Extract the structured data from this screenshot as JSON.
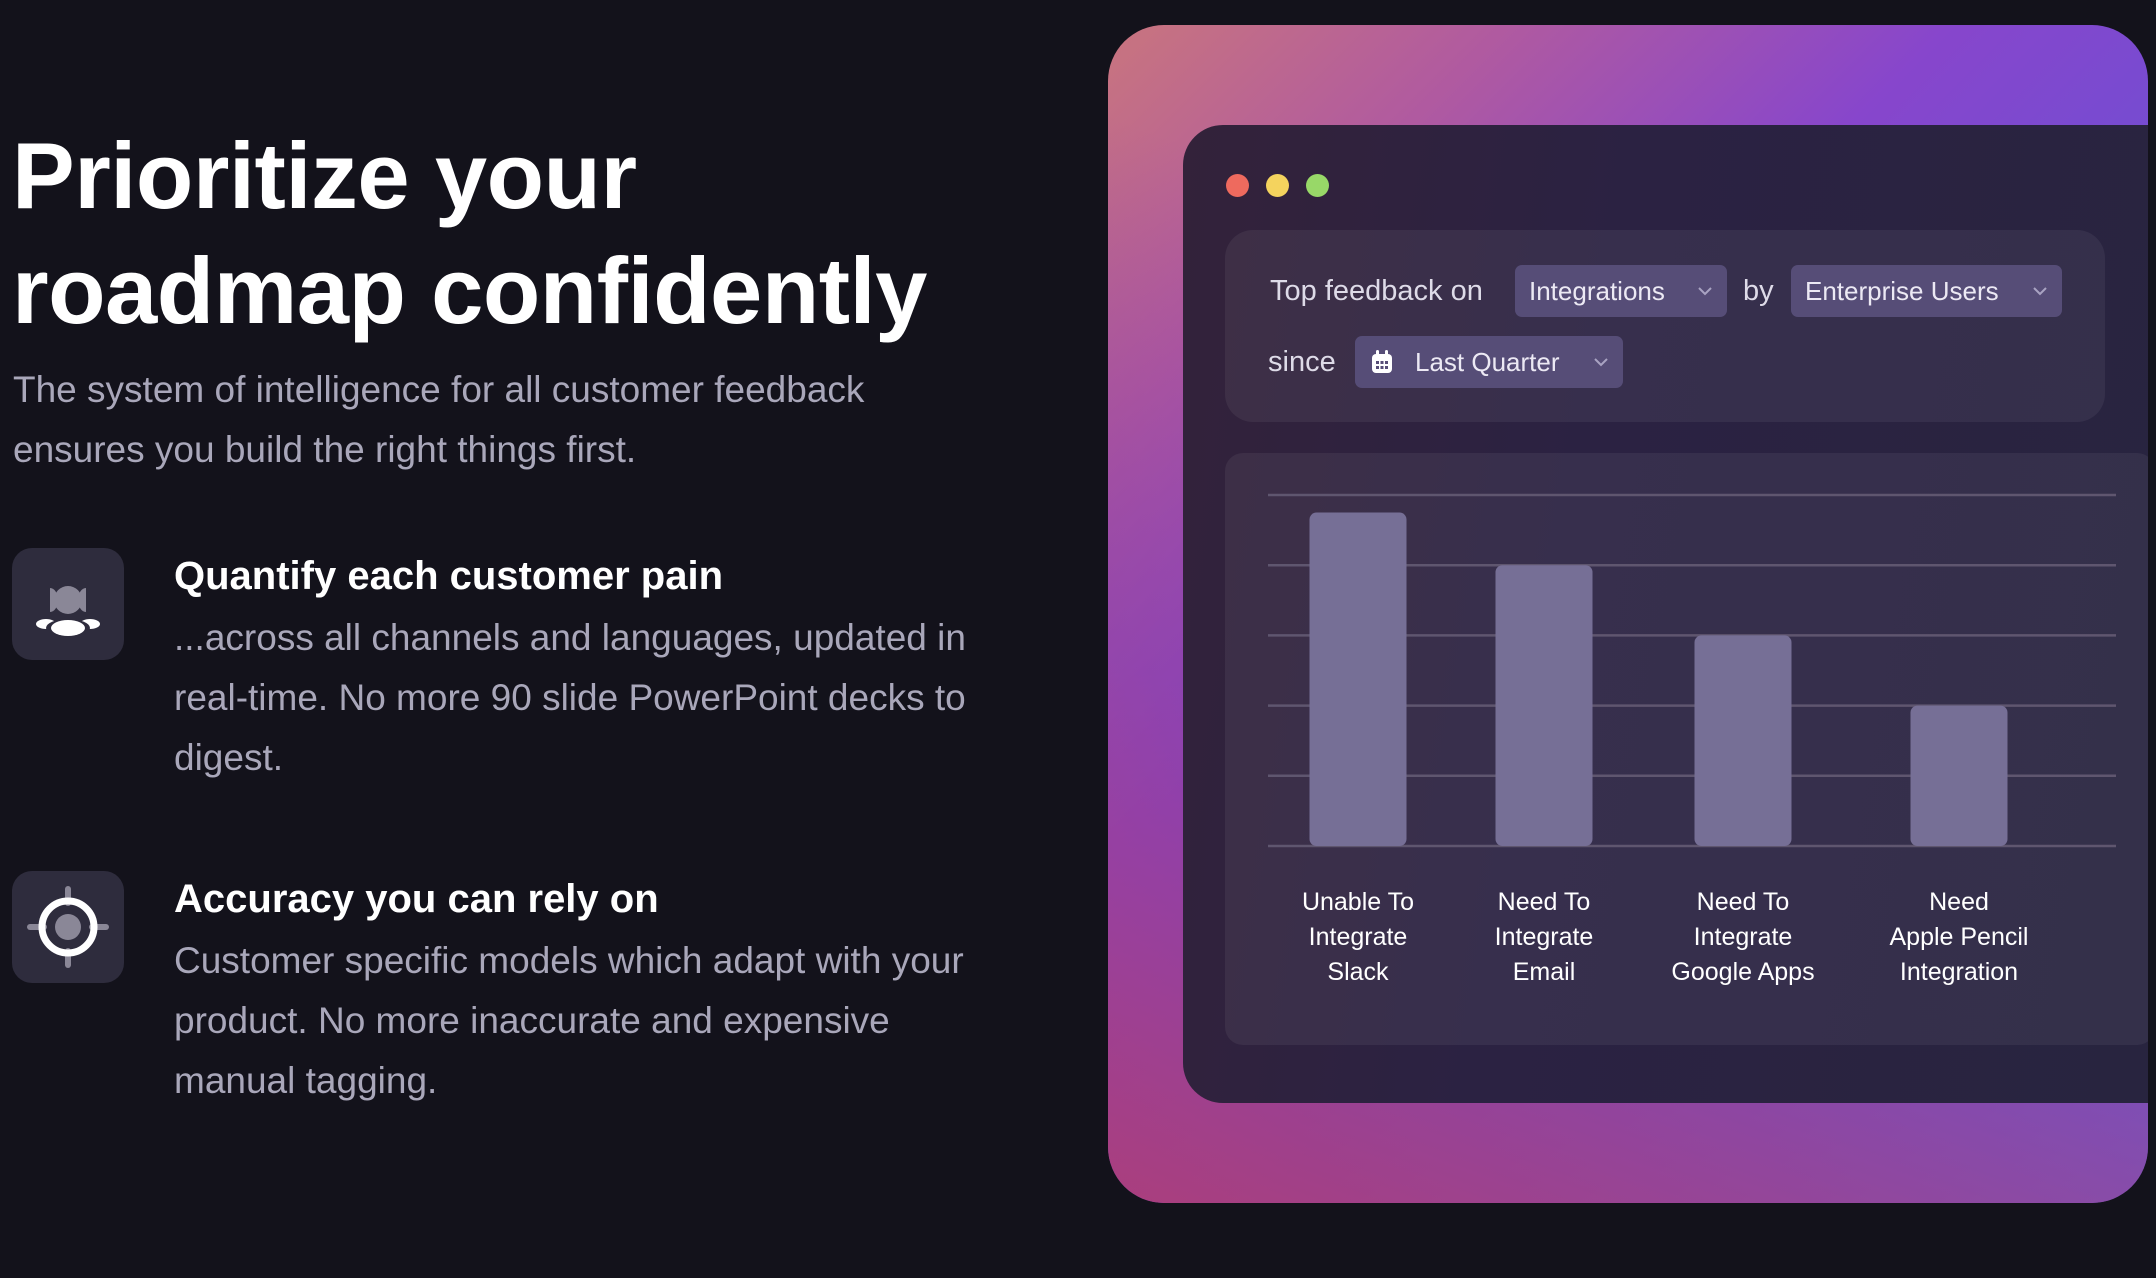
{
  "hero": {
    "title_line1": "Prioritize your",
    "title_line2": "roadmap confidently",
    "subtitle_line1": "The system of intelligence for all customer feedback",
    "subtitle_line2": "ensures you build the right things first."
  },
  "features": [
    {
      "icon": "users-group-icon",
      "title": "Quantify each customer pain",
      "body_lines": [
        "...across all channels and languages, updated in",
        "real-time. No more 90 slide PowerPoint decks to",
        "digest."
      ]
    },
    {
      "icon": "crosshair-target-icon",
      "title": "Accuracy you can rely on",
      "body_lines": [
        "Customer specific models which adapt with your",
        "product. No more inaccurate and expensive",
        "manual tagging."
      ]
    }
  ],
  "window": {
    "traffic_lights": [
      {
        "name": "close",
        "color": "#ee6a5e"
      },
      {
        "name": "minimize",
        "color": "#f4d35e"
      },
      {
        "name": "maximize",
        "color": "#98d868"
      }
    ]
  },
  "filter": {
    "prefix": "Top feedback on",
    "topic": {
      "value": "Integrations",
      "icon": "chevron-down-icon"
    },
    "by_label": "by",
    "segment": {
      "value": "Enterprise Users",
      "icon": "chevron-down-icon"
    },
    "since_label": "since",
    "period": {
      "value": "Last Quarter",
      "leading_icon": "calendar-icon",
      "icon": "chevron-down-icon"
    }
  },
  "colors": {
    "background": "#13121b",
    "bar": "#766f96",
    "gridline": "#5f566f",
    "pill": "#564d77",
    "body_text": "#a9a7ba"
  },
  "chart_data": {
    "type": "bar",
    "title": "",
    "xlabel": "",
    "ylabel": "",
    "categories": [
      [
        "Unable To",
        "Integrate",
        "Slack"
      ],
      [
        "Need To",
        "Integrate",
        "Email"
      ],
      [
        "Need To",
        "Integrate",
        "Google Apps"
      ],
      [
        "Need",
        "Apple Pencil",
        "Integration"
      ]
    ],
    "values": [
      4.75,
      4.0,
      3.0,
      2.0
    ],
    "ylim": [
      0,
      5
    ],
    "gridlines": [
      0,
      1,
      2,
      3,
      4,
      5
    ],
    "grid": true,
    "y_tick_labels_shown": false,
    "legend": "none"
  }
}
